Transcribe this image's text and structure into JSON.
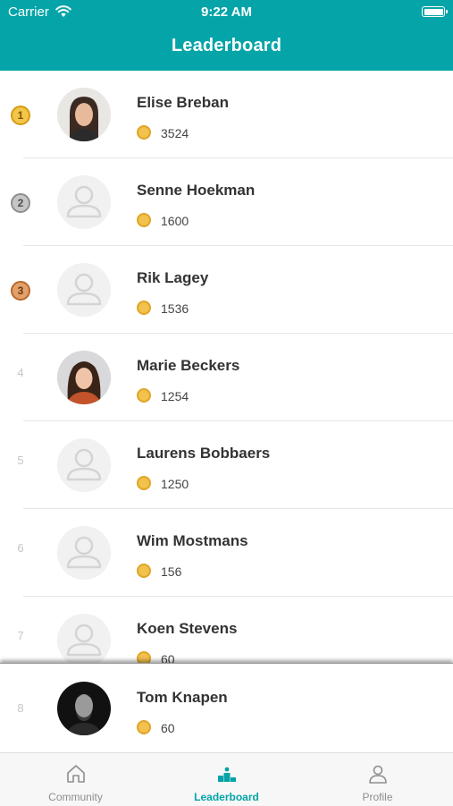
{
  "status_bar": {
    "carrier": "Carrier",
    "time": "9:22 AM"
  },
  "header": {
    "title": "Leaderboard"
  },
  "leaderboard": [
    {
      "rank": "1",
      "medal": "gold",
      "name": "Elise Breban",
      "points": "3524",
      "avatar": "photo-woman-long-hair"
    },
    {
      "rank": "2",
      "medal": "silver",
      "name": "Senne Hoekman",
      "points": "1600",
      "avatar": "placeholder"
    },
    {
      "rank": "3",
      "medal": "bronze",
      "name": "Rik Lagey",
      "points": "1536",
      "avatar": "placeholder"
    },
    {
      "rank": "4",
      "name": "Marie Beckers",
      "points": "1254",
      "avatar": "photo-woman-curly-hair"
    },
    {
      "rank": "5",
      "name": "Laurens Bobbaers",
      "points": "1250",
      "avatar": "placeholder"
    },
    {
      "rank": "6",
      "name": "Wim Mostmans",
      "points": "156",
      "avatar": "placeholder"
    },
    {
      "rank": "7",
      "name": "Koen Stevens",
      "points": "60",
      "avatar": "placeholder"
    }
  ],
  "current_user": {
    "rank": "8",
    "name": "Tom Knapen",
    "points": "60",
    "avatar": "photo-man-beard"
  },
  "tabs": [
    {
      "label": "Community",
      "icon": "home-icon",
      "active": false
    },
    {
      "label": "Leaderboard",
      "icon": "podium-icon",
      "active": true
    },
    {
      "label": "Profile",
      "icon": "person-icon",
      "active": false
    }
  ],
  "colors": {
    "primary": "#05a4a8",
    "gold": "#f3c64a",
    "silver": "#c6c6c6",
    "bronze": "#e3a06a",
    "coin": "#f2c14e"
  }
}
